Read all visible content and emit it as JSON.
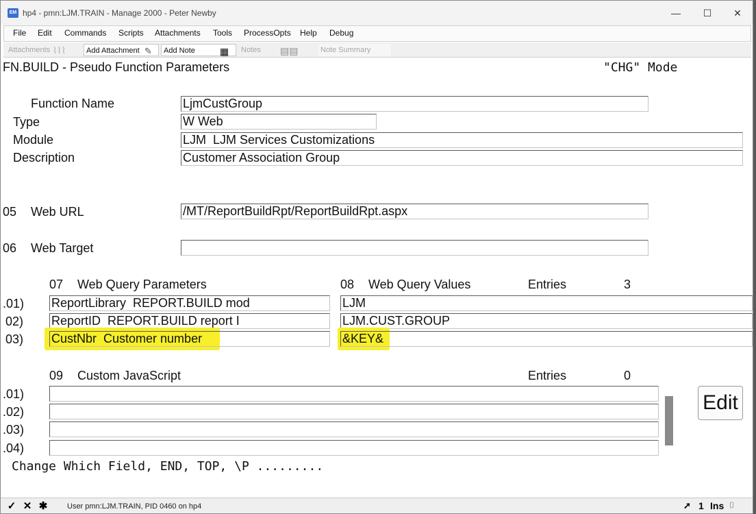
{
  "window": {
    "title": "hp4 - pmn:LJM.TRAIN - Manage 2000 - Peter Newby",
    "app_icon_text": "EM",
    "controls": {
      "minimize": "—",
      "maximize": "☐",
      "close": "✕"
    }
  },
  "menu": {
    "items": [
      "File",
      "Edit",
      "Commands",
      "Scripts",
      "Attachments",
      "Tools",
      "ProcessOpts",
      "Help",
      "Debug"
    ]
  },
  "toolbar": {
    "attachments": "Attachments",
    "add_attachment": "Add Attachment",
    "add_note": "Add Note",
    "notes": "Notes",
    "note_summary": "Note Summary"
  },
  "screen": {
    "title": "FN.BUILD - Pseudo Function Parameters",
    "mode": "\"CHG\" Mode"
  },
  "fields": {
    "function_name": {
      "label": "Function Name",
      "value": "LjmCustGroup"
    },
    "type": {
      "label": "Type",
      "value": "W Web"
    },
    "module": {
      "label": "Module",
      "value": "LJM  LJM Services Customizations"
    },
    "description": {
      "label": "Description",
      "value": "Customer Association Group"
    },
    "web_url": {
      "number": "05",
      "label": "Web URL",
      "value": "/MT/ReportBuildRpt/ReportBuildRpt.aspx"
    },
    "web_target": {
      "number": "06",
      "label": "Web Target",
      "value": ""
    }
  },
  "query": {
    "params_number": "07",
    "params_label": "Web Query Parameters",
    "values_number": "08",
    "values_label": "Web Query Values",
    "entries_label": "Entries",
    "entries_count": "3",
    "rows": [
      {
        "index": ".01)",
        "param": "ReportLibrary  REPORT.BUILD mod",
        "value": "LJM"
      },
      {
        "index": "02)",
        "param": "ReportID  REPORT.BUILD report I",
        "value": "LJM.CUST.GROUP"
      },
      {
        "index": "03)",
        "param": "CustNbr  Customer number",
        "value": "&KEY&"
      }
    ]
  },
  "javascript": {
    "number": "09",
    "label": "Custom JavaScript",
    "entries_label": "Entries",
    "entries_count": "0",
    "rows": [
      {
        "index": ".01)",
        "value": ""
      },
      {
        "index": ".02)",
        "value": ""
      },
      {
        "index": ".03)",
        "value": ""
      },
      {
        "index": ".04)",
        "value": ""
      }
    ],
    "edit_button": "Edit"
  },
  "prompt": "Change Which Field, END, TOP, \\P .........",
  "status": {
    "check": "✓",
    "cross": "✕",
    "star": "✱",
    "user_text": "User pmn:LJM.TRAIN, PID 0460 on hp4",
    "line_number": "1",
    "ins": "Ins"
  },
  "colors": {
    "highlight": "#f7ef2a",
    "app_icon": "#3b6fd1"
  }
}
